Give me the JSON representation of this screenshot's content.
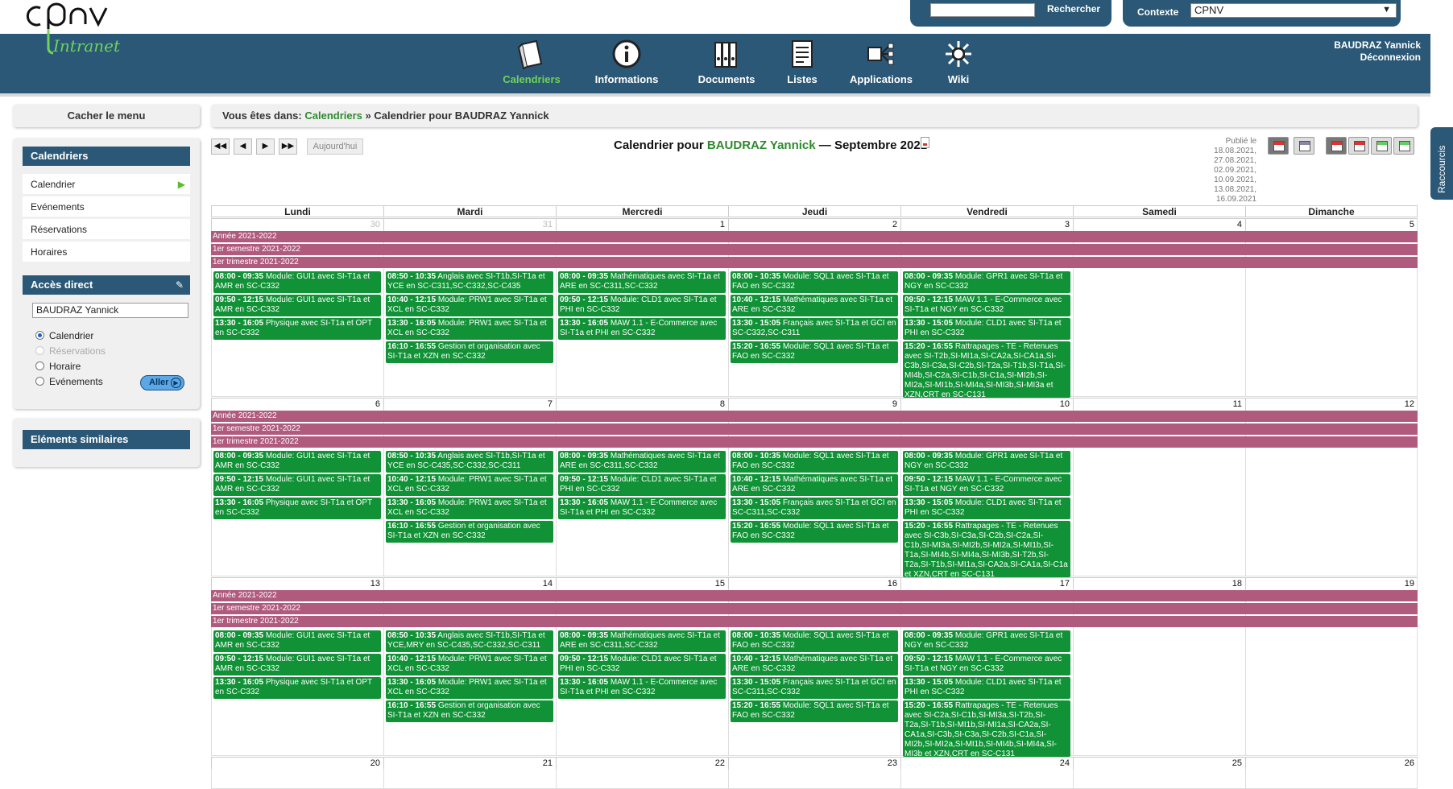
{
  "brand": {
    "logo_text": "cpnv",
    "logo_sub": "Intranet",
    "colors": {
      "nav": "#2b5876",
      "accent": "#6fd35a",
      "event": "#119236",
      "band": "#b05a7e"
    }
  },
  "search": {
    "placeholder": "",
    "button": "Rechercher"
  },
  "context": {
    "label": "Contexte",
    "value": "CPNV"
  },
  "nav": {
    "items": [
      {
        "label": "Calendriers",
        "icon": "calendar-book-icon",
        "active": true
      },
      {
        "label": "Informations",
        "icon": "info-icon"
      },
      {
        "label": "Documents",
        "icon": "binders-icon"
      },
      {
        "label": "Listes",
        "icon": "list-sheet-icon"
      },
      {
        "label": "Applications",
        "icon": "network-icon"
      },
      {
        "label": "Wiki",
        "icon": "gear-network-icon"
      }
    ],
    "user": "BAUDRAZ Yannick",
    "logout": "Déconnexion"
  },
  "sidebar": {
    "hide_menu": "Cacher le menu",
    "calendars_title": "Calendriers",
    "items": [
      {
        "label": "Calendrier"
      },
      {
        "label": "Evénements"
      },
      {
        "label": "Réservations"
      },
      {
        "label": "Horaires"
      }
    ],
    "direct_title": "Accès direct",
    "direct_value": "BAUDRAZ Yannick",
    "radios": [
      "Calendrier",
      "Réservations",
      "Horaire",
      "Evénements"
    ],
    "go": "Aller",
    "similar_title": "Eléments similaires"
  },
  "breadcrumb": {
    "prefix": "Vous êtes dans:",
    "link": "Calendriers",
    "sep": "»",
    "current": "Calendrier pour BAUDRAZ Yannick"
  },
  "toolbar": {
    "first": "◀◀",
    "prev": "◀",
    "next": "▶",
    "last": "▶▶",
    "today": "Aujourd'hui"
  },
  "cal": {
    "title_prefix": "Calendrier pour",
    "title_person": "BAUDRAZ Yannick",
    "title_suffix": "— Septembre 2021",
    "published_label": "Publié le",
    "published_dates": [
      "18.08.2021,",
      "27.08.2021,",
      "02.09.2021,",
      "10.09.2021,",
      "13.08.2021,",
      "16.09.2021"
    ],
    "days": [
      "Lundi",
      "Mardi",
      "Mercredi",
      "Jeudi",
      "Vendredi",
      "Samedi",
      "Dimanche"
    ],
    "bands": [
      "Année 2021-2022",
      "1er semestre 2021-2022",
      "1er trimestre 2021-2022"
    ],
    "weeks": [
      {
        "dates": [
          "30",
          "31",
          "1",
          "2",
          "3",
          "4",
          "5"
        ],
        "muted": [
          true,
          true,
          false,
          false,
          false,
          false,
          false
        ],
        "events": [
          [
            {
              "t": "08:00 - 09:35",
              "d": "Module: GUI1 avec SI-T1a et AMR en SC-C332"
            },
            {
              "t": "09:50 - 12:15",
              "d": "Module: GUI1 avec SI-T1a et AMR en SC-C332"
            },
            {
              "t": "13:30 - 16:05",
              "d": "Physique avec SI-T1a et OPT en SC-C332"
            }
          ],
          [
            {
              "t": "08:50 - 10:35",
              "d": "Anglais avec SI-T1b,SI-T1a et YCE en SC-C311,SC-C332,SC-C435"
            },
            {
              "t": "10:40 - 12:15",
              "d": "Module: PRW1 avec SI-T1a et XCL en SC-C332"
            },
            {
              "t": "13:30 - 16:05",
              "d": "Module: PRW1 avec SI-T1a et XCL en SC-C332"
            },
            {
              "t": "16:10 - 16:55",
              "d": "Gestion et organisation avec SI-T1a et XZN en SC-C332"
            }
          ],
          [
            {
              "t": "08:00 - 09:35",
              "d": "Mathématiques avec SI-T1a et ARE en SC-C311,SC-C332"
            },
            {
              "t": "09:50 - 12:15",
              "d": "Module: CLD1 avec SI-T1a et PHI en SC-C332"
            },
            {
              "t": "13:30 - 16:05",
              "d": "MAW 1.1 - E-Commerce avec SI-T1a et PHI en SC-C332"
            }
          ],
          [
            {
              "t": "08:00 - 10:35",
              "d": "Module: SQL1 avec SI-T1a et FAO en SC-C332"
            },
            {
              "t": "10:40 - 12:15",
              "d": "Mathématiques avec SI-T1a et ARE en SC-C332"
            },
            {
              "t": "13:30 - 15:05",
              "d": "Français avec SI-T1a et GCI en SC-C332,SC-C311"
            },
            {
              "t": "15:20 - 16:55",
              "d": "Module: SQL1 avec SI-T1a et FAO en SC-C332"
            }
          ],
          [
            {
              "t": "08:00 - 09:35",
              "d": "Module: GPR1 avec SI-T1a et NGY en SC-C332"
            },
            {
              "t": "09:50 - 12:15",
              "d": "MAW 1.1 - E-Commerce avec SI-T1a et NGY en SC-C332"
            },
            {
              "t": "13:30 - 15:05",
              "d": "Module: CLD1 avec SI-T1a et PHI en SC-C332"
            },
            {
              "t": "15:20 - 16:55",
              "d": "Rattrapages - TE - Retenues avec SI-T2b,SI-MI1a,SI-CA2a,SI-CA1a,SI-C3b,SI-C3a,SI-C2b,SI-T2a,SI-T1b,SI-T1a,SI-MI4b,SI-C2a,SI-C1b,SI-C1a,SI-MI2b,SI-MI2a,SI-MI1b,SI-MI4a,SI-MI3b,SI-MI3a et XZN,CRT en SC-C131"
            }
          ],
          [],
          []
        ]
      },
      {
        "dates": [
          "6",
          "7",
          "8",
          "9",
          "10",
          "11",
          "12"
        ],
        "muted": [
          false,
          false,
          false,
          false,
          false,
          false,
          false
        ],
        "events": [
          [
            {
              "t": "08:00 - 09:35",
              "d": "Module: GUI1 avec SI-T1a et AMR en SC-C332"
            },
            {
              "t": "09:50 - 12:15",
              "d": "Module: GUI1 avec SI-T1a et AMR en SC-C332"
            },
            {
              "t": "13:30 - 16:05",
              "d": "Physique avec SI-T1a et OPT en SC-C332"
            }
          ],
          [
            {
              "t": "08:50 - 10:35",
              "d": "Anglais avec SI-T1b,SI-T1a et YCE en SC-C435,SC-C332,SC-C311"
            },
            {
              "t": "10:40 - 12:15",
              "d": "Module: PRW1 avec SI-T1a et XCL en SC-C332"
            },
            {
              "t": "13:30 - 16:05",
              "d": "Module: PRW1 avec SI-T1a et XCL en SC-C332"
            },
            {
              "t": "16:10 - 16:55",
              "d": "Gestion et organisation avec SI-T1a et XZN en SC-C332"
            }
          ],
          [
            {
              "t": "08:00 - 09:35",
              "d": "Mathématiques avec SI-T1a et ARE en SC-C311,SC-C332"
            },
            {
              "t": "09:50 - 12:15",
              "d": "Module: CLD1 avec SI-T1a et PHI en SC-C332"
            },
            {
              "t": "13:30 - 16:05",
              "d": "MAW 1.1 - E-Commerce avec SI-T1a et PHI en SC-C332"
            }
          ],
          [
            {
              "t": "08:00 - 10:35",
              "d": "Module: SQL1 avec SI-T1a et FAO en SC-C332"
            },
            {
              "t": "10:40 - 12:15",
              "d": "Mathématiques avec SI-T1a et ARE en SC-C332"
            },
            {
              "t": "13:30 - 15:05",
              "d": "Français avec SI-T1a et GCI en SC-C311,SC-C332"
            },
            {
              "t": "15:20 - 16:55",
              "d": "Module: SQL1 avec SI-T1a et FAO en SC-C332"
            }
          ],
          [
            {
              "t": "08:00 - 09:35",
              "d": "Module: GPR1 avec SI-T1a et NGY en SC-C332"
            },
            {
              "t": "09:50 - 12:15",
              "d": "MAW 1.1 - E-Commerce avec SI-T1a et NGY en SC-C332"
            },
            {
              "t": "13:30 - 15:05",
              "d": "Module: CLD1 avec SI-T1a et PHI en SC-C332"
            },
            {
              "t": "15:20 - 16:55",
              "d": "Rattrapages - TE - Retenues avec SI-C3b,SI-C3a,SI-C2b,SI-C2a,SI-C1b,SI-MI3a,SI-MI2b,SI-MI2a,SI-MI1b,SI-T1a,SI-MI4b,SI-MI4a,SI-MI3b,SI-T2b,SI-T2a,SI-T1b,SI-MI1a,SI-CA2a,SI-CA1a,SI-C1a et XZN,CRT en SC-C131"
            }
          ],
          [],
          []
        ]
      },
      {
        "dates": [
          "13",
          "14",
          "15",
          "16",
          "17",
          "18",
          "19"
        ],
        "muted": [
          false,
          false,
          false,
          false,
          false,
          false,
          false
        ],
        "events": [
          [
            {
              "t": "08:00 - 09:35",
              "d": "Module: GUI1 avec SI-T1a et AMR en SC-C332"
            },
            {
              "t": "09:50 - 12:15",
              "d": "Module: GUI1 avec SI-T1a et AMR en SC-C332"
            },
            {
              "t": "13:30 - 16:05",
              "d": "Physique avec SI-T1a et OPT en SC-C332"
            }
          ],
          [
            {
              "t": "08:50 - 10:35",
              "d": "Anglais avec SI-T1b,SI-T1a et YCE,MRY en SC-C435,SC-C332,SC-C311"
            },
            {
              "t": "10:40 - 12:15",
              "d": "Module: PRW1 avec SI-T1a et XCL en SC-C332"
            },
            {
              "t": "13:30 - 16:05",
              "d": "Module: PRW1 avec SI-T1a et XCL en SC-C332"
            },
            {
              "t": "16:10 - 16:55",
              "d": "Gestion et organisation avec SI-T1a et XZN en SC-C332"
            }
          ],
          [
            {
              "t": "08:00 - 09:35",
              "d": "Mathématiques avec SI-T1a et ARE en SC-C311,SC-C332"
            },
            {
              "t": "09:50 - 12:15",
              "d": "Module: CLD1 avec SI-T1a et PHI en SC-C332"
            },
            {
              "t": "13:30 - 16:05",
              "d": "MAW 1.1 - E-Commerce avec SI-T1a et PHI en SC-C332"
            }
          ],
          [
            {
              "t": "08:00 - 10:35",
              "d": "Module: SQL1 avec SI-T1a et FAO en SC-C332"
            },
            {
              "t": "10:40 - 12:15",
              "d": "Mathématiques avec SI-T1a et ARE en SC-C332"
            },
            {
              "t": "13:30 - 15:05",
              "d": "Français avec SI-T1a et GCI en SC-C311,SC-C332"
            },
            {
              "t": "15:20 - 16:55",
              "d": "Module: SQL1 avec SI-T1a et FAO en SC-C332"
            }
          ],
          [
            {
              "t": "08:00 - 09:35",
              "d": "Module: GPR1 avec SI-T1a et NGY en SC-C332"
            },
            {
              "t": "09:50 - 12:15",
              "d": "MAW 1.1 - E-Commerce avec SI-T1a et NGY en SC-C332"
            },
            {
              "t": "13:30 - 15:05",
              "d": "Module: CLD1 avec SI-T1a et PHI en SC-C332"
            },
            {
              "t": "15:20 - 16:55",
              "d": "Rattrapages - TE - Retenues avec SI-C2a,SI-C1b,SI-MI3a,SI-T2b,SI-T2a,SI-T1b,SI-MI1b,SI-MI1a,SI-CA2a,SI-CA1a,SI-C3b,SI-C3a,SI-C2b,SI-C1a,SI-MI2b,SI-MI2a,SI-MI1b,SI-MI4b,SI-MI4a,SI-MI3b et XZN,CRT en SC-C131"
            }
          ],
          [],
          []
        ]
      },
      {
        "dates": [
          "20",
          "21",
          "22",
          "23",
          "24",
          "25",
          "26"
        ],
        "muted": [
          false,
          false,
          false,
          false,
          false,
          false,
          false
        ],
        "events": [
          [],
          [],
          [],
          [],
          [],
          [],
          []
        ]
      }
    ]
  },
  "shortcuts": {
    "label": "Raccourcis"
  }
}
